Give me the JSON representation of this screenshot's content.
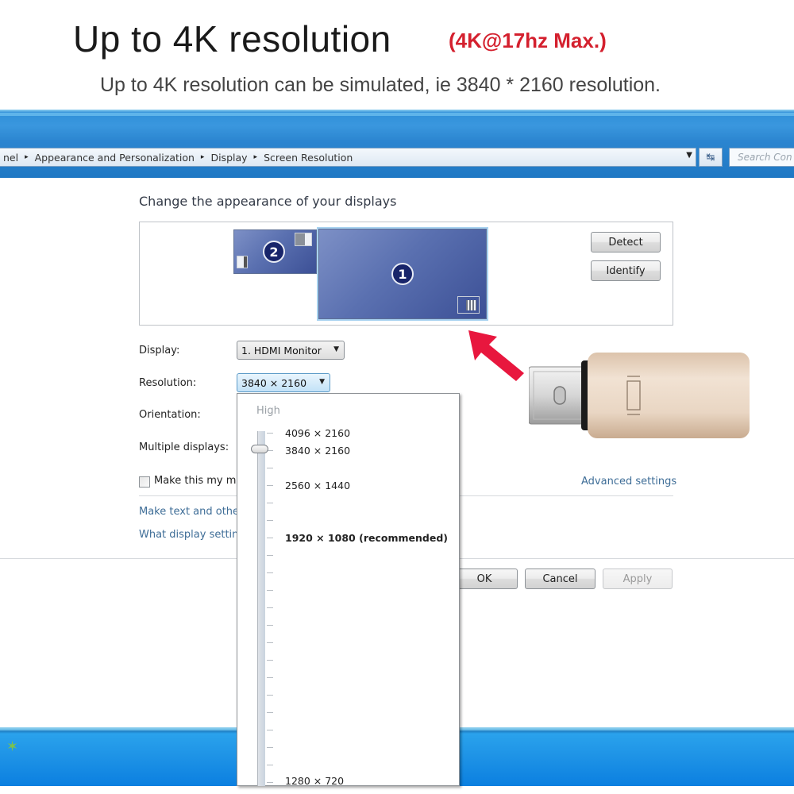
{
  "promo": {
    "headline": "Up to 4K resolution",
    "badge": "(4K@17hz Max.)",
    "subline": "Up to 4K resolution can be simulated, ie 3840 * 2160 resolution.",
    "badge_color": "#d4202e"
  },
  "window": {
    "breadcrumb": [
      "nel",
      "Appearance and Personalization",
      "Display",
      "Screen Resolution"
    ],
    "search_placeholder": "Search Con"
  },
  "screen_resolution": {
    "title": "Change the appearance of your displays",
    "monitors": [
      {
        "number": "1",
        "selected": true
      },
      {
        "number": "2",
        "selected": false
      }
    ],
    "buttons": {
      "detect": "Detect",
      "identify": "Identify",
      "ok": "OK",
      "cancel": "Cancel",
      "apply": "Apply"
    },
    "fields": {
      "display_label": "Display:",
      "display_value": "1. HDMI Monitor",
      "resolution_label": "Resolution:",
      "resolution_value": "3840 × 2160",
      "orientation_label": "Orientation:",
      "multiple_label": "Multiple displays:"
    },
    "checkbox_label": "Make this my ma",
    "checkbox_checked": false,
    "links": {
      "advanced": "Advanced settings",
      "text_size": "Make text and other",
      "what_settings": "What display setting"
    },
    "resolution_dropdown": {
      "high_label": "High",
      "selected": "3840 × 2160",
      "options": [
        {
          "label": "4096 × 2160",
          "bold": false
        },
        {
          "label": "3840 × 2160",
          "bold": false
        },
        {
          "label": "2560 × 1440",
          "bold": false
        },
        {
          "label": "1920 × 1080 (recommended)",
          "bold": true
        },
        {
          "label": "1280 × 720",
          "bold": false
        }
      ]
    }
  },
  "icons": {
    "arrow": "red-arrow-icon",
    "adapter": "mini-displayport-adapter-icon",
    "breadcrumb_sep": "▸",
    "dropdown_caret": "▼",
    "refresh": "↹"
  }
}
